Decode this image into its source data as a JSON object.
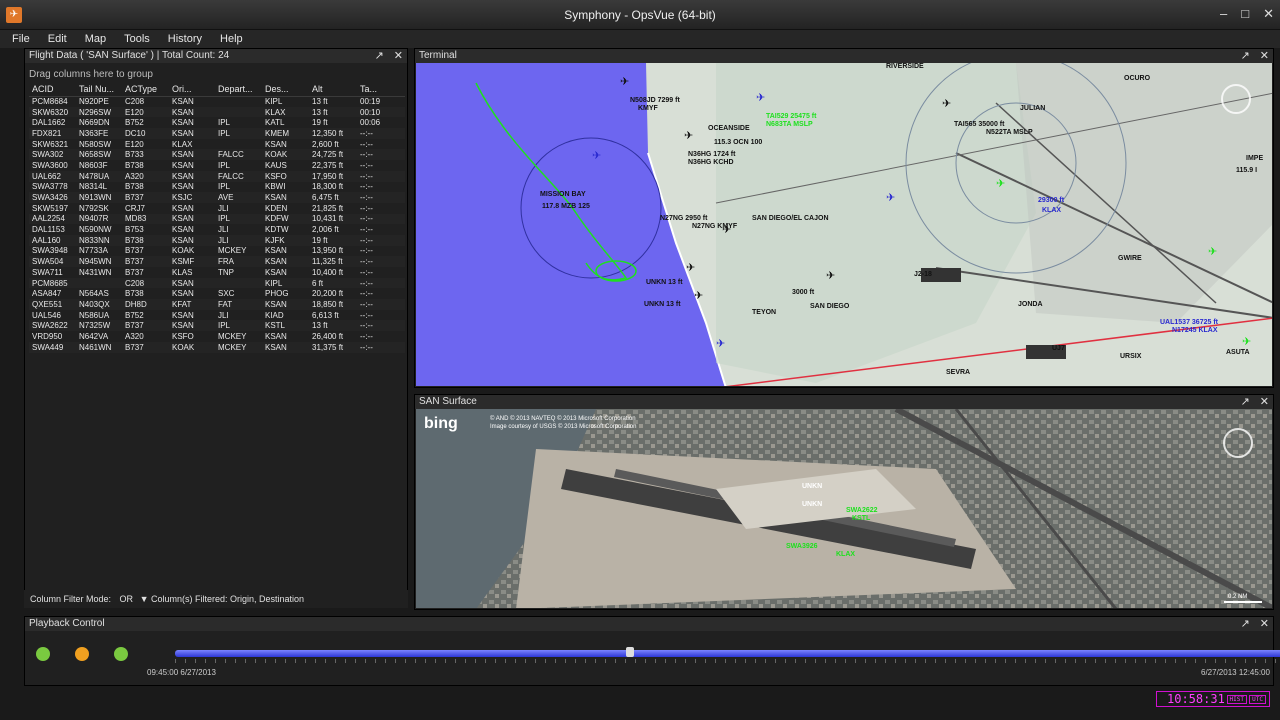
{
  "window": {
    "title": "Symphony - OpsVue (64-bit)",
    "controls": [
      "–",
      "□",
      "✕"
    ]
  },
  "menu": [
    "File",
    "Edit",
    "Map",
    "Tools",
    "History",
    "Help"
  ],
  "flight_panel": {
    "title": "Flight Data ( 'SAN Surface' ) | Total Count: 24",
    "group_hint": "Drag columns here to group",
    "columns": [
      "ACID",
      "Tail Nu...",
      "ACType",
      "Ori...",
      "Depart...",
      "Des...",
      "Alt",
      "Ta..."
    ],
    "rows": [
      [
        "PCM8684",
        "N920PE",
        "C208",
        "KSAN",
        "",
        "KIPL",
        "13 ft",
        "00:19"
      ],
      [
        "SKW6320",
        "N296SW",
        "E120",
        "KSAN",
        "",
        "KLAX",
        "13 ft",
        "00:10"
      ],
      [
        "DAL1662",
        "N669DN",
        "B752",
        "KSAN",
        "IPL",
        "KATL",
        "19 ft",
        "00:06"
      ],
      [
        "FDX821",
        "N363FE",
        "DC10",
        "KSAN",
        "IPL",
        "KMEM",
        "12,350 ft",
        "--:--"
      ],
      [
        "SKW6321",
        "N580SW",
        "E120",
        "KLAX",
        "",
        "KSAN",
        "2,600 ft",
        "--:--"
      ],
      [
        "SWA302",
        "N658SW",
        "B733",
        "KSAN",
        "FALCC",
        "KOAK",
        "24,725 ft",
        "--:--"
      ],
      [
        "SWA3600",
        "N8603F",
        "B738",
        "KSAN",
        "IPL",
        "KAUS",
        "22,375 ft",
        "--:--"
      ],
      [
        "UAL662",
        "N478UA",
        "A320",
        "KSAN",
        "FALCC",
        "KSFO",
        "17,950 ft",
        "--:--"
      ],
      [
        "SWA3778",
        "N8314L",
        "B738",
        "KSAN",
        "IPL",
        "KBWI",
        "18,300 ft",
        "--:--"
      ],
      [
        "SWA3426",
        "N913WN",
        "B737",
        "KSJC",
        "AVE",
        "KSAN",
        "6,475 ft",
        "--:--"
      ],
      [
        "SKW5197",
        "N792SK",
        "CRJ7",
        "KSAN",
        "JLI",
        "KDEN",
        "21,825 ft",
        "--:--"
      ],
      [
        "AAL2254",
        "N9407R",
        "MD83",
        "KSAN",
        "IPL",
        "KDFW",
        "10,431 ft",
        "--:--"
      ],
      [
        "DAL1153",
        "N590NW",
        "B753",
        "KSAN",
        "JLI",
        "KDTW",
        "2,006 ft",
        "--:--"
      ],
      [
        "AAL160",
        "N833NN",
        "B738",
        "KSAN",
        "JLI",
        "KJFK",
        "19 ft",
        "--:--"
      ],
      [
        "SWA3948",
        "N7733A",
        "B737",
        "KOAK",
        "MCKEY",
        "KSAN",
        "13,950 ft",
        "--:--"
      ],
      [
        "SWA504",
        "N945WN",
        "B737",
        "KSMF",
        "FRA",
        "KSAN",
        "11,325 ft",
        "--:--"
      ],
      [
        "SWA711",
        "N431WN",
        "B737",
        "KLAS",
        "TNP",
        "KSAN",
        "10,400 ft",
        "--:--"
      ],
      [
        "PCM8685",
        "",
        "C208",
        "KSAN",
        "",
        "KIPL",
        "6 ft",
        "--:--"
      ],
      [
        "ASA847",
        "N564AS",
        "B738",
        "KSAN",
        "SXC",
        "PHOG",
        "20,200 ft",
        "--:--"
      ],
      [
        "QXE551",
        "N403QX",
        "DH8D",
        "KFAT",
        "FAT",
        "KSAN",
        "18,850 ft",
        "--:--"
      ],
      [
        "UAL546",
        "N586UA",
        "B752",
        "KSAN",
        "JLI",
        "KIAD",
        "6,613 ft",
        "--:--"
      ],
      [
        "SWA2622",
        "N7325W",
        "B737",
        "KSAN",
        "IPL",
        "KSTL",
        "13 ft",
        "--:--"
      ],
      [
        "VRD950",
        "N642VA",
        "A320",
        "KSFO",
        "MCKEY",
        "KSAN",
        "26,400 ft",
        "--:--"
      ],
      [
        "SWA449",
        "N461WN",
        "B737",
        "KOAK",
        "MCKEY",
        "KSAN",
        "31,375 ft",
        "--:--"
      ]
    ],
    "filter_mode_label": "Column Filter Mode:",
    "filter_mode_value": "OR",
    "filtered_text": "Column(s) Filtered: Origin, Destination"
  },
  "terminal": {
    "title": "Terminal",
    "labels": [
      {
        "t": "N508JD  7299 ft",
        "c": "black"
      },
      {
        "t": "KMYF",
        "c": "black"
      },
      {
        "t": "OCEANSIDE",
        "c": "black"
      },
      {
        "t": "115.3 OCN 100",
        "c": "black"
      },
      {
        "t": "N36HG  1724 ft",
        "c": "black"
      },
      {
        "t": "N36HG  KCHD",
        "c": "black"
      },
      {
        "t": "TAI529   25475 ft",
        "c": "green"
      },
      {
        "t": "N683TA   MSLP",
        "c": "green"
      },
      {
        "t": "TAI565   35000 ft",
        "c": "black"
      },
      {
        "t": "N522TA   MSLP",
        "c": "black"
      },
      {
        "t": "JULIAN",
        "c": "black"
      },
      {
        "t": "MISSION BAY",
        "c": "black"
      },
      {
        "t": "117.8 MZB 125",
        "c": "black"
      },
      {
        "t": "N27NG  2950 ft",
        "c": "black"
      },
      {
        "t": "N27NG  KMYF",
        "c": "black"
      },
      {
        "t": "SAN DIEGO/EL CAJON",
        "c": "black"
      },
      {
        "t": "UNKN   13 ft",
        "c": "black"
      },
      {
        "t": "UNKN   13 ft",
        "c": "black"
      },
      {
        "t": "3000 ft",
        "c": "black"
      },
      {
        "t": "TEYON",
        "c": "black"
      },
      {
        "t": "SAN DIEGO",
        "c": "black"
      },
      {
        "t": "JONDA",
        "c": "black"
      },
      {
        "t": "GWIRE",
        "c": "black"
      },
      {
        "t": "UAL1537  36725 ft",
        "c": "blue"
      },
      {
        "t": "N17245   KLAX",
        "c": "blue"
      },
      {
        "t": "29300 ft",
        "c": "blue"
      },
      {
        "t": "KLAX",
        "c": "blue"
      },
      {
        "t": "URSIX",
        "c": "black"
      },
      {
        "t": "ASUTA",
        "c": "black"
      },
      {
        "t": "SEVRA",
        "c": "black"
      },
      {
        "t": "RIVERSIDE",
        "c": "black"
      },
      {
        "t": "OCURO",
        "c": "black"
      },
      {
        "t": "IMPE",
        "c": "black"
      },
      {
        "t": "115.9 I",
        "c": "black"
      },
      {
        "t": "J2-18",
        "c": "black"
      },
      {
        "t": "UJ7",
        "c": "black"
      }
    ]
  },
  "surface": {
    "title": "SAN Surface",
    "bing": "bing",
    "copyright": "© AND  © 2013 NAVTEQ  © 2013 Microsoft Corporation",
    "copyright2": "Image courtesy of USGS  © 2013 Microsoft Corporation",
    "labels": [
      {
        "t": "UNKN",
        "c": "white"
      },
      {
        "t": "UNKN",
        "c": "white"
      },
      {
        "t": "SWA3926",
        "c": "green"
      },
      {
        "t": "KLAX",
        "c": "green"
      },
      {
        "t": "SWA2622",
        "c": "green"
      },
      {
        "t": "KSTL",
        "c": "green"
      }
    ],
    "scale": "0.2 NM"
  },
  "playback": {
    "title": "Playback Control",
    "start": "09:45:00 6/27/2013",
    "end": "6/27/2013 12:45:00",
    "position": 0.409
  },
  "clock": {
    "time": "10:58:31",
    "mode": "HIST",
    "zone": "UTC"
  },
  "colors": {
    "track": "#3f48e8",
    "highlight": "#ff40ff",
    "aircraft_green": "#1ee01e"
  }
}
